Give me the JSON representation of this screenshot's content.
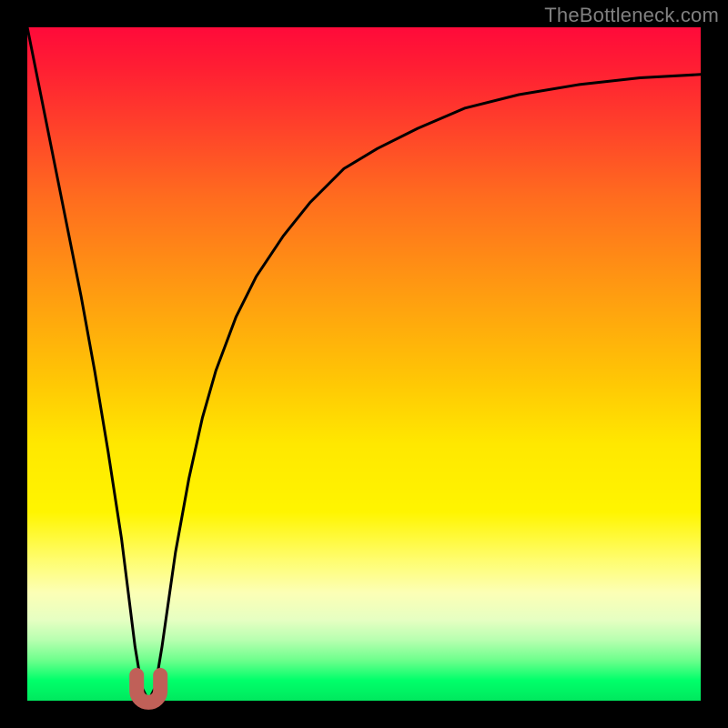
{
  "attribution": "TheBottleneck.com",
  "chart_data": {
    "type": "line",
    "title": "",
    "xlabel": "",
    "ylabel": "",
    "xlim": [
      0,
      100
    ],
    "ylim": [
      0,
      100
    ],
    "grid": false,
    "legend": false,
    "series": [
      {
        "name": "bottleneck-curve",
        "x": [
          0,
          2,
          4,
          6,
          8,
          10,
          12,
          14,
          15,
          16,
          17,
          18,
          19,
          20,
          21,
          22,
          24,
          26,
          28,
          31,
          34,
          38,
          42,
          47,
          52,
          58,
          65,
          73,
          82,
          91,
          100
        ],
        "y": [
          100,
          90,
          80,
          70,
          60,
          49,
          37,
          24,
          16,
          8,
          2,
          0,
          2,
          8,
          15,
          22,
          33,
          42,
          49,
          57,
          63,
          69,
          74,
          79,
          82,
          85,
          88,
          90,
          91.5,
          92.5,
          93
        ]
      }
    ],
    "marker": {
      "name": "optimal-point",
      "x": 18,
      "y": 1.5,
      "color": "#c06058"
    },
    "background_gradient": {
      "top": "#ff0a3a",
      "mid": "#ffe800",
      "bottom": "#00ff6a"
    }
  }
}
